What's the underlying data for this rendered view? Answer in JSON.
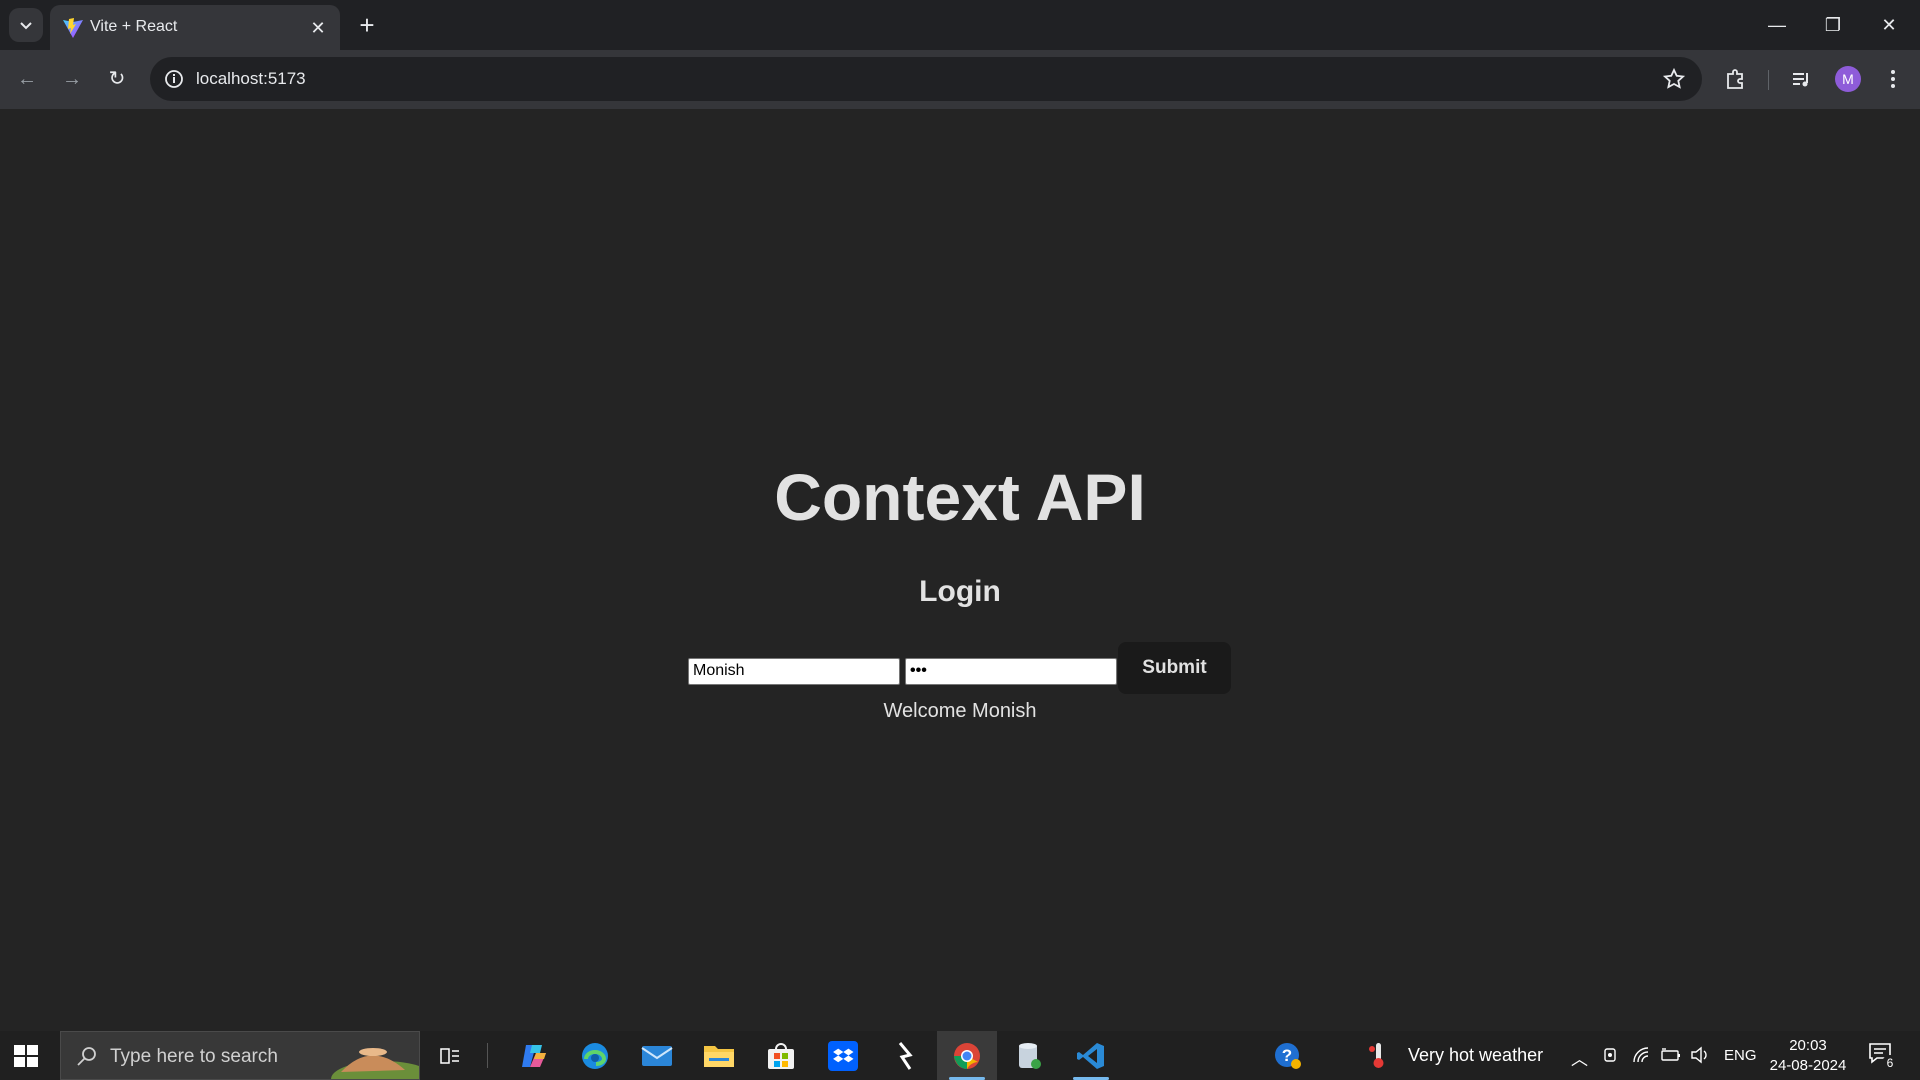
{
  "browser": {
    "tab_title": "Vite + React",
    "url": "localhost:5173",
    "profile_initial": "M"
  },
  "page": {
    "heading": "Context API",
    "subheading": "Login",
    "username_value": "Monish",
    "password_value": "•••",
    "submit_label": "Submit",
    "welcome_text": "Welcome Monish"
  },
  "taskbar": {
    "search_placeholder": "Type here to search",
    "weather": "Very hot weather",
    "language": "ENG",
    "time": "20:03",
    "date": "24-08-2024",
    "notification_count": "6"
  },
  "colors": {
    "page_bg": "#242424",
    "button_bg": "#1a1a1a",
    "accent": "#76b9ed"
  }
}
